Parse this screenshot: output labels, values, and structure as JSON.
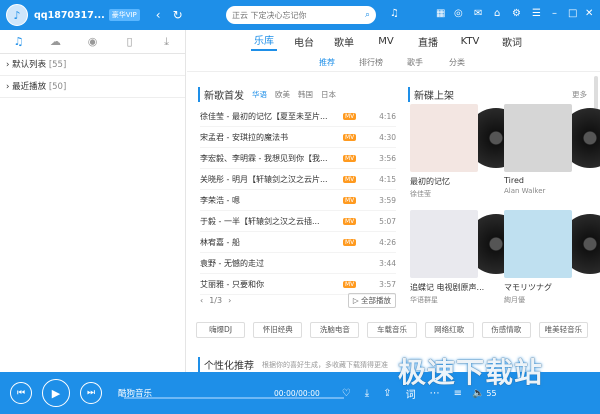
{
  "app": {
    "username": "qq1870317...",
    "vip_label": "豪华VIP",
    "search_placeholder": "正云 下定决心忘记你"
  },
  "left": {
    "playlists": [
      {
        "label": "默认列表",
        "count": "[55]"
      },
      {
        "label": "最近播放",
        "count": "[50]"
      }
    ]
  },
  "nav": {
    "tabs": [
      "乐库",
      "电台",
      "歌单",
      "MV",
      "直播",
      "KTV",
      "歌词"
    ],
    "active_tab": "乐库",
    "subtabs": [
      "推荐",
      "排行榜",
      "歌手",
      "分类"
    ],
    "active_subtab": "推荐"
  },
  "new_songs": {
    "title": "新歌首发",
    "filters": [
      "华语",
      "欧美",
      "韩国",
      "日本"
    ],
    "songs": [
      {
        "name": "徐佳莹 - 最初的记忆【夏至未至片...",
        "badge": "MV",
        "duration": "4:16"
      },
      {
        "name": "宋孟君 - 安琪拉的魔法书",
        "badge": "MV",
        "duration": "4:30"
      },
      {
        "name": "李宏毅、李明霖 - 我想见到你【我...",
        "badge": "MV",
        "duration": "3:56"
      },
      {
        "name": "关晓彤 - 明月【轩辕剑之汉之云片...",
        "badge": "MV",
        "duration": "4:15"
      },
      {
        "name": "李荣浩 - 嗯",
        "badge": "MV",
        "duration": "3:59"
      },
      {
        "name": "于毅 - 一半【轩辕剑之汉之云插...",
        "badge": "MV",
        "duration": "5:07"
      },
      {
        "name": "林宥嘉 - 船",
        "badge": "MV",
        "duration": "4:26"
      },
      {
        "name": "袁野 - 无憾的走过",
        "badge": "",
        "duration": "3:44"
      },
      {
        "name": "艾丽雅 - 只要和你",
        "badge": "MV",
        "duration": "3:57"
      }
    ],
    "page": "1/3",
    "play_all": "全部播放"
  },
  "albums": {
    "title": "新碟上架",
    "more": "更多",
    "items": [
      {
        "name": "最初的记忆",
        "artist": "徐佳莹",
        "color": "#f3e6e2"
      },
      {
        "name": "Tired",
        "artist": "Alan Walker",
        "color": "#d6d6d6"
      },
      {
        "name": "追蝶记 电视剧原声...",
        "artist": "华语群星",
        "color": "#e9e9ee"
      },
      {
        "name": "マモリツナグ",
        "artist": "絢月優",
        "color": "#bfe0f0"
      }
    ]
  },
  "tags": [
    "嗨爆DJ",
    "怀旧经典",
    "洗脑电音",
    "车载音乐",
    "网络红歌",
    "伤感情歌",
    "唯美轻音乐"
  ],
  "personal": {
    "title": "个性化推荐",
    "desc": "根据你的喜好生成，多收藏下载猜得更准",
    "more": "更多"
  },
  "player": {
    "track": "酷狗音乐",
    "time": "00:00/00:00",
    "volume": "55",
    "progress": 0
  },
  "watermark": "极速下载站",
  "colors": {
    "brand": "#1e8fe8"
  }
}
